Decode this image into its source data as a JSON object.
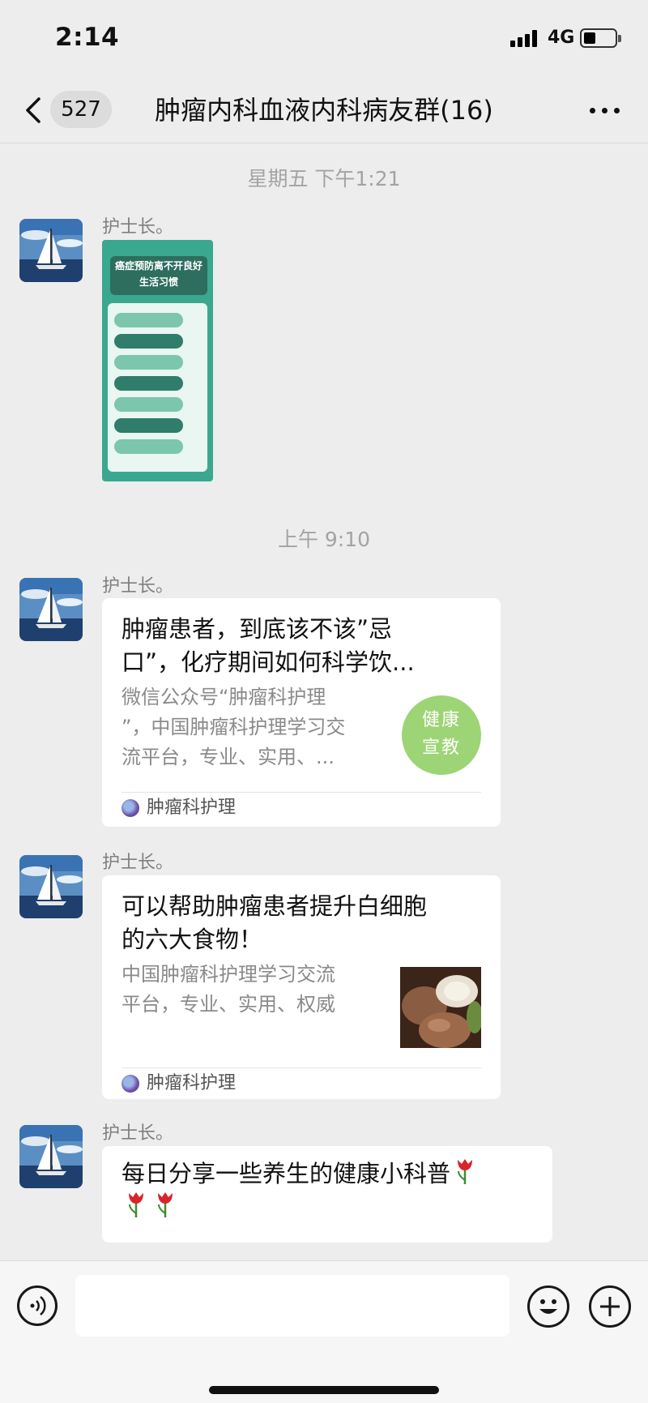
{
  "status_bar": {
    "time": "2:14",
    "network": "4G"
  },
  "nav": {
    "unread_count": "527",
    "title": "肿瘤内科血液内科病友群(16)"
  },
  "messages": [
    {
      "timestamp": "星期五 下午1:21",
      "sender": "护士长。",
      "type": "image",
      "poster_title": "癌症预防离不开良好生活习惯"
    },
    {
      "timestamp": "上午 9:10",
      "sender": "护士长。",
      "type": "link-card",
      "title": "肿瘤患者，到底该不该”忌口”，化疗期间如何科学饮...",
      "title_line1": "肿瘤患者，到底该不该”忌",
      "title_line2": "口”，化疗期间如何科学饮...",
      "desc_line1": "微信公众号“肿瘤科护理",
      "desc_line2": "”，中国肿瘤科护理学习交",
      "desc_line3": "流平台，专业、实用、...",
      "thumb_line1": "健康",
      "thumb_line2": "宣教",
      "source": "肿瘤科护理"
    },
    {
      "sender": "护士长。",
      "type": "link-card",
      "title_line1": "可以帮助肿瘤患者提升白细胞",
      "title_line2": "的六大食物！",
      "desc_line1": "中国肿瘤科护理学习交流",
      "desc_line2": "平台，专业、实用、权威",
      "source": "肿瘤科护理"
    },
    {
      "sender": "护士长。",
      "type": "text",
      "text": "每日分享一些养生的健康小科普",
      "emoji": "tulip"
    }
  ],
  "colors": {
    "background": "#ededed",
    "bubble": "#ffffff",
    "poster_green": "#3aa88e",
    "health_thumb": "#9dd475"
  },
  "icons": [
    "back-chevron-icon",
    "more-icon",
    "voice-icon",
    "emoji-icon",
    "plus-icon",
    "tulip-icon"
  ]
}
